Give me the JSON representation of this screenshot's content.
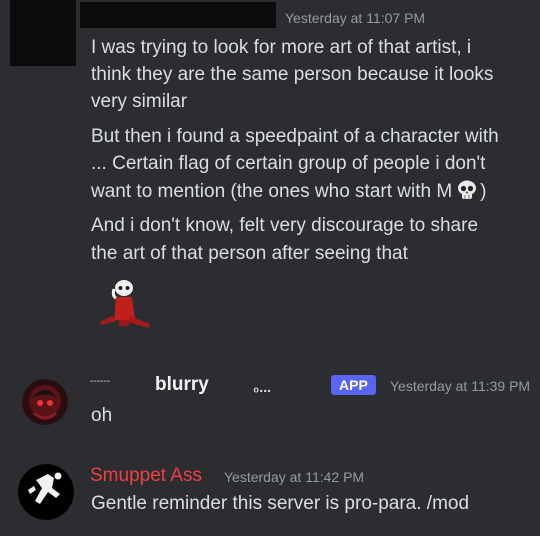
{
  "messages": [
    {
      "timestamp": "Yesterday at 11:07 PM",
      "lines": [
        "I was trying to look for more art of that artist, i",
        "think they are the same person because it looks",
        "very similar",
        "But then i found a speedpaint of a character with",
        "... Certain flag of certain group of people i don't",
        "want to mention (the ones who start with M",
        ")",
        "And i don't know, felt very discourage to share",
        "the art of that person after seeing that"
      ],
      "emoji": "skull-emoji"
    },
    {
      "username_prefix": "------",
      "username": "blurry",
      "username_suffix": "₀...",
      "badge": "APP",
      "timestamp": "Yesterday at 11:39 PM",
      "text": "oh"
    },
    {
      "username": "Smuppet Ass",
      "timestamp": "Yesterday at 11:42 PM",
      "text": "Gentle reminder this server is pro-para. /mod"
    }
  ],
  "colors": {
    "background": "#2b2d31",
    "text": "#dbdee1",
    "timestamp": "#949ba4",
    "app_badge": "#5865f2",
    "mod_name": "#f23f42"
  }
}
